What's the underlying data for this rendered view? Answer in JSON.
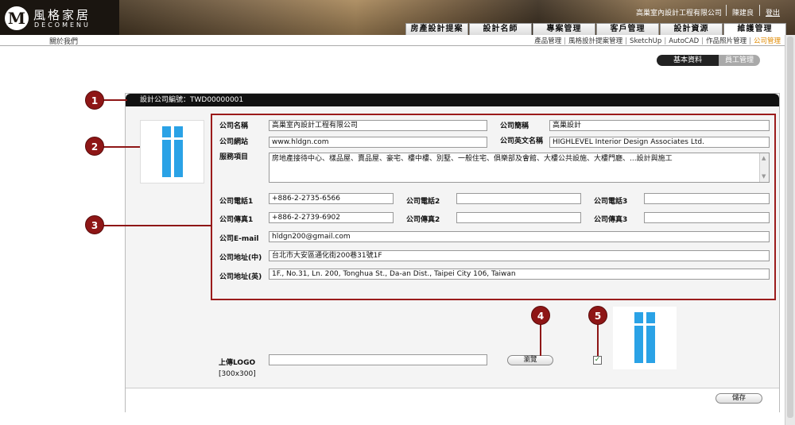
{
  "header": {
    "logo_mark": "M",
    "logo_cn": "風格家居",
    "logo_en": "DECOMENU",
    "company": "高巢室內設計工程有限公司",
    "user": "陳建良",
    "logout": "登出"
  },
  "tabs": [
    {
      "label": "房產設計提案"
    },
    {
      "label": "設計名師"
    },
    {
      "label": "專案管理"
    },
    {
      "label": "客戶管理"
    },
    {
      "label": "設計資源"
    },
    {
      "label": "維護管理",
      "active": true
    }
  ],
  "subbar": {
    "about": "關於我們",
    "items": [
      {
        "label": "產品管理"
      },
      {
        "label": "風格設計提案管理"
      },
      {
        "label": "SketchUp"
      },
      {
        "label": "AutoCAD"
      },
      {
        "label": "作品照片管理"
      },
      {
        "label": "公司管理",
        "active": true
      }
    ]
  },
  "right_tabs": {
    "basic": "基本資料",
    "staff": "員工管理"
  },
  "panel": {
    "title": "設計公司編號：TWD00000001"
  },
  "form": {
    "name_label": "公司名稱",
    "name_value": "高巢室內設計工程有限公司",
    "short_label": "公司簡稱",
    "short_value": "高巢設計",
    "web_label": "公司網站",
    "web_value": "www.hldgn.com",
    "en_name_label": "公司英文名稱",
    "en_name_value": "HIGHLEVEL Interior Design Associates Ltd.",
    "service_label": "服務項目",
    "service_value": "房地產接待中心、樣品屋、賣品屋、豪宅、樓中樓、別墅、一般住宅、俱樂部及會館、大樓公共設施、大樓門廳、...設計與施工",
    "tel1_label": "公司電話1",
    "tel1_value": "+886-2-2735-6566",
    "tel2_label": "公司電話2",
    "tel2_value": "",
    "tel3_label": "公司電話3",
    "tel3_value": "",
    "fax1_label": "公司傳真1",
    "fax1_value": "+886-2-2739-6902",
    "fax2_label": "公司傳真2",
    "fax2_value": "",
    "fax3_label": "公司傳真3",
    "fax3_value": "",
    "email_label": "公司E-mail",
    "email_value": "hldgn200@gmail.com",
    "addr_cn_label": "公司地址(中)",
    "addr_cn_value": "台北市大安區通化街200巷31號1F",
    "addr_en_label": "公司地址(英)",
    "addr_en_value": "1F., No.31, Ln. 200, Tonghua St., Da-an Dist., Taipei City 106, Taiwan"
  },
  "upload": {
    "label": "上傳LOGO",
    "size_hint": "[300x300]",
    "browse": "瀏覽",
    "checkbox_checked": true
  },
  "footer": {
    "save": "儲存"
  },
  "callouts": [
    "1",
    "2",
    "3",
    "4",
    "5"
  ],
  "colors": {
    "callout": "#8e1616",
    "outline": "#9b1b1b",
    "logo_blue": "#2aa2e6",
    "active_link": "#e08a00"
  }
}
